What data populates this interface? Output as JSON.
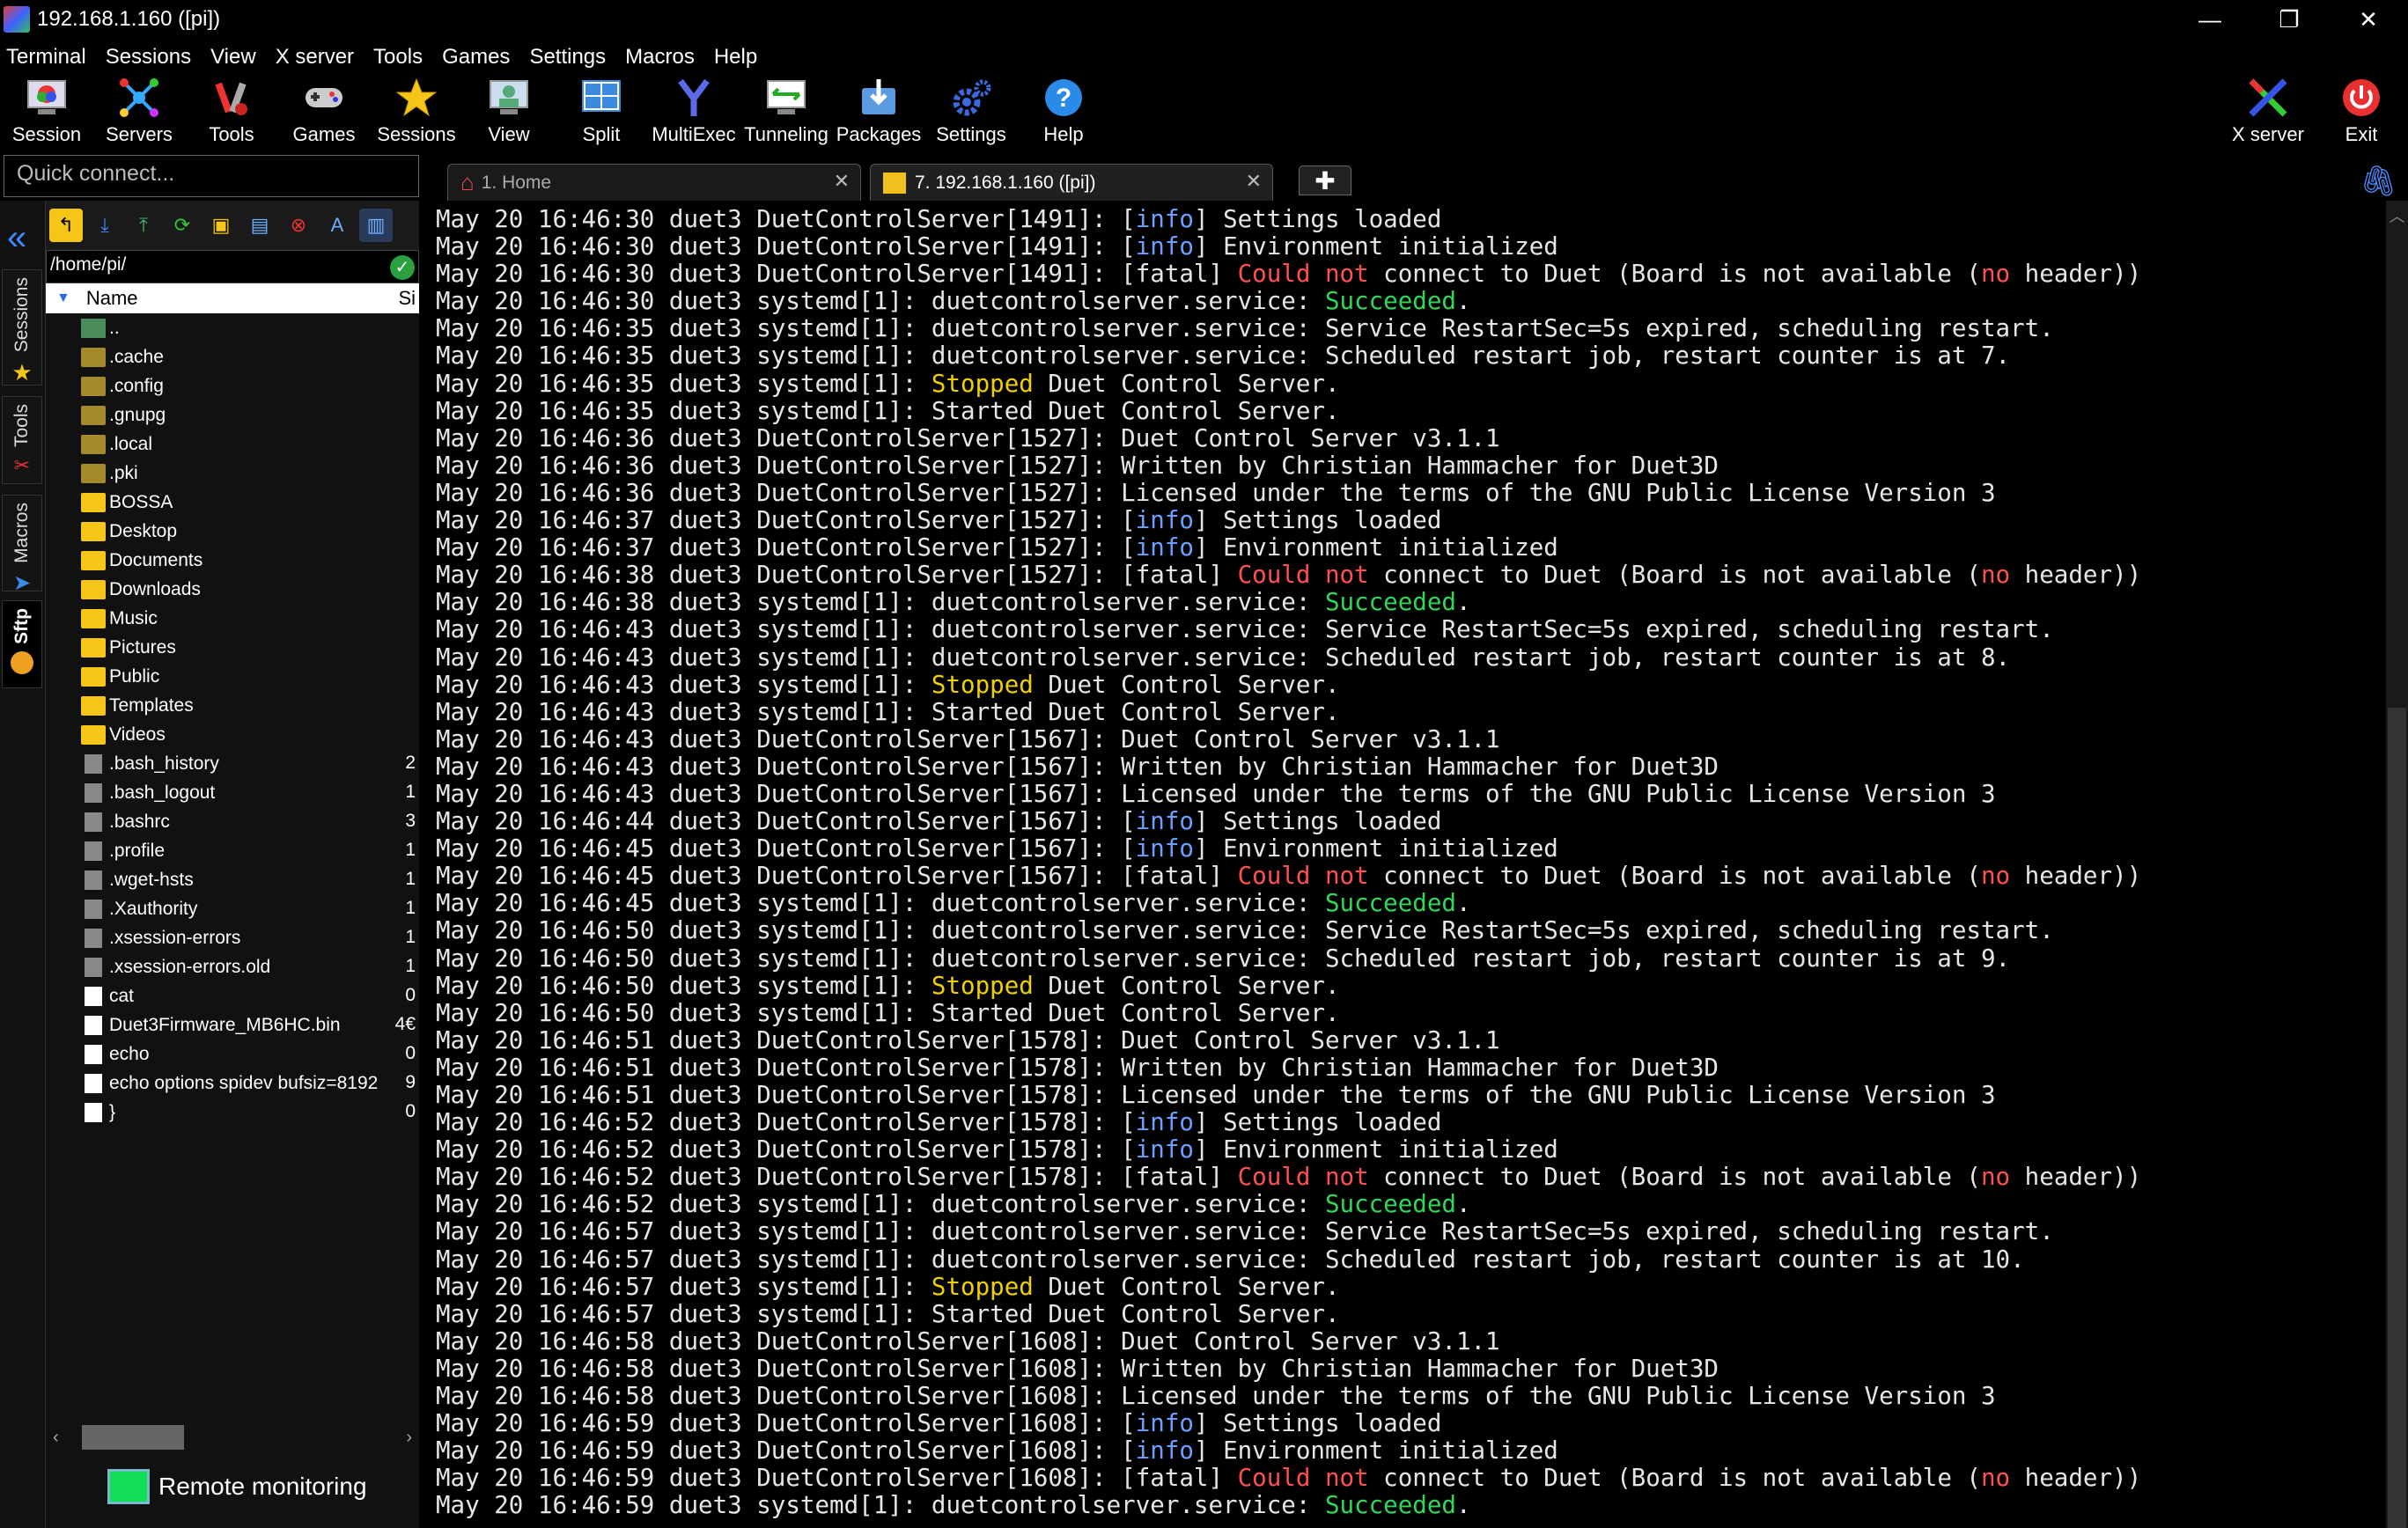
{
  "window": {
    "title": "192.168.1.160 ([pi])",
    "minimize": "—",
    "restore": "❐",
    "close": "✕"
  },
  "menu": [
    "Terminal",
    "Sessions",
    "View",
    "X server",
    "Tools",
    "Games",
    "Settings",
    "Macros",
    "Help"
  ],
  "toolbar": {
    "session": "Session",
    "servers": "Servers",
    "tools": "Tools",
    "games": "Games",
    "sessions": "Sessions",
    "view": "View",
    "split": "Split",
    "multiexec": "MultiExec",
    "tunneling": "Tunneling",
    "packages": "Packages",
    "settings": "Settings",
    "help": "Help",
    "xserver": "X server",
    "exit": "Exit"
  },
  "quick_connect": {
    "placeholder": "Quick connect..."
  },
  "tabs": [
    {
      "label": "1. Home"
    },
    {
      "label": "7. 192.168.1.160 ([pi])"
    }
  ],
  "side_tabs": {
    "sessions": "Sessions",
    "tools": "Tools",
    "macros": "Macros",
    "sftp": "Sftp"
  },
  "sftp": {
    "path": "/home/pi/",
    "col_name": "Name",
    "col_size": "Si",
    "files": [
      {
        "name": "..",
        "size": "",
        "kind": "up"
      },
      {
        "name": ".cache",
        "size": "",
        "kind": "hfolder"
      },
      {
        "name": ".config",
        "size": "",
        "kind": "hfolder"
      },
      {
        "name": ".gnupg",
        "size": "",
        "kind": "hfolder"
      },
      {
        "name": ".local",
        "size": "",
        "kind": "hfolder"
      },
      {
        "name": ".pki",
        "size": "",
        "kind": "hfolder"
      },
      {
        "name": "BOSSA",
        "size": "",
        "kind": "folder"
      },
      {
        "name": "Desktop",
        "size": "",
        "kind": "folder"
      },
      {
        "name": "Documents",
        "size": "",
        "kind": "folder"
      },
      {
        "name": "Downloads",
        "size": "",
        "kind": "folder"
      },
      {
        "name": "Music",
        "size": "",
        "kind": "folder"
      },
      {
        "name": "Pictures",
        "size": "",
        "kind": "folder"
      },
      {
        "name": "Public",
        "size": "",
        "kind": "folder"
      },
      {
        "name": "Templates",
        "size": "",
        "kind": "folder"
      },
      {
        "name": "Videos",
        "size": "",
        "kind": "folder"
      },
      {
        "name": ".bash_history",
        "size": "2",
        "kind": "hfile"
      },
      {
        "name": ".bash_logout",
        "size": "1",
        "kind": "hfile"
      },
      {
        "name": ".bashrc",
        "size": "3",
        "kind": "hfile"
      },
      {
        "name": ".profile",
        "size": "1",
        "kind": "hfile"
      },
      {
        "name": ".wget-hsts",
        "size": "1",
        "kind": "hfile"
      },
      {
        "name": ".Xauthority",
        "size": "1",
        "kind": "hfile"
      },
      {
        "name": ".xsession-errors",
        "size": "1",
        "kind": "hfile"
      },
      {
        "name": ".xsession-errors.old",
        "size": "1",
        "kind": "hfile"
      },
      {
        "name": "cat",
        "size": "0",
        "kind": "file"
      },
      {
        "name": "Duet3Firmware_MB6HC.bin",
        "size": "4€",
        "kind": "file"
      },
      {
        "name": "echo",
        "size": "0",
        "kind": "file"
      },
      {
        "name": "echo options spidev bufsiz=8192",
        "size": "9",
        "kind": "file"
      },
      {
        "name": "}",
        "size": "0",
        "kind": "file"
      }
    ],
    "monitor": "Remote monitoring"
  },
  "terminal": {
    "lines": [
      [
        [
          "May 20 16:46:30 duet3 DuetControlServer[1491]: [",
          ""
        ],
        [
          "info",
          "info"
        ],
        [
          "] Settings loaded",
          ""
        ]
      ],
      [
        [
          "May 20 16:46:30 duet3 DuetControlServer[1491]: [",
          ""
        ],
        [
          "info",
          "info"
        ],
        [
          "] Environment initialized",
          ""
        ]
      ],
      [
        [
          "May 20 16:46:30 duet3 DuetControlServer[1491]: [fatal] ",
          ""
        ],
        [
          "Could not",
          "red"
        ],
        [
          " connect to Duet (Board is not available (",
          ""
        ],
        [
          "no",
          "red"
        ],
        [
          " header))",
          ""
        ]
      ],
      [
        [
          "May 20 16:46:30 duet3 systemd[1]: duetcontrolserver.service: ",
          ""
        ],
        [
          "Succeeded",
          "grn"
        ],
        [
          ".",
          ""
        ]
      ],
      [
        [
          "May 20 16:46:35 duet3 systemd[1]: duetcontrolserver.service: Service RestartSec=5s expired, scheduling restart.",
          ""
        ]
      ],
      [
        [
          "May 20 16:46:35 duet3 systemd[1]: duetcontrolserver.service: Scheduled restart job, restart counter is at 7.",
          ""
        ]
      ],
      [
        [
          "May 20 16:46:35 duet3 systemd[1]: ",
          ""
        ],
        [
          "Stopped",
          "yel"
        ],
        [
          " Duet Control Server.",
          ""
        ]
      ],
      [
        [
          "May 20 16:46:35 duet3 systemd[1]: Started Duet Control Server.",
          ""
        ]
      ],
      [
        [
          "May 20 16:46:36 duet3 DuetControlServer[1527]: Duet Control Server v3.1.1",
          ""
        ]
      ],
      [
        [
          "May 20 16:46:36 duet3 DuetControlServer[1527]: Written by Christian Hammacher for Duet3D",
          ""
        ]
      ],
      [
        [
          "May 20 16:46:36 duet3 DuetControlServer[1527]: Licensed under the terms of the GNU Public License Version 3",
          ""
        ]
      ],
      [
        [
          "May 20 16:46:37 duet3 DuetControlServer[1527]: [",
          ""
        ],
        [
          "info",
          "info"
        ],
        [
          "] Settings loaded",
          ""
        ]
      ],
      [
        [
          "May 20 16:46:37 duet3 DuetControlServer[1527]: [",
          ""
        ],
        [
          "info",
          "info"
        ],
        [
          "] Environment initialized",
          ""
        ]
      ],
      [
        [
          "May 20 16:46:38 duet3 DuetControlServer[1527]: [fatal] ",
          ""
        ],
        [
          "Could not",
          "red"
        ],
        [
          " connect to Duet (Board is not available (",
          ""
        ],
        [
          "no",
          "red"
        ],
        [
          " header))",
          ""
        ]
      ],
      [
        [
          "May 20 16:46:38 duet3 systemd[1]: duetcontrolserver.service: ",
          ""
        ],
        [
          "Succeeded",
          "grn"
        ],
        [
          ".",
          ""
        ]
      ],
      [
        [
          "May 20 16:46:43 duet3 systemd[1]: duetcontrolserver.service: Service RestartSec=5s expired, scheduling restart.",
          ""
        ]
      ],
      [
        [
          "May 20 16:46:43 duet3 systemd[1]: duetcontrolserver.service: Scheduled restart job, restart counter is at 8.",
          ""
        ]
      ],
      [
        [
          "May 20 16:46:43 duet3 systemd[1]: ",
          ""
        ],
        [
          "Stopped",
          "yel"
        ],
        [
          " Duet Control Server.",
          ""
        ]
      ],
      [
        [
          "May 20 16:46:43 duet3 systemd[1]: Started Duet Control Server.",
          ""
        ]
      ],
      [
        [
          "May 20 16:46:43 duet3 DuetControlServer[1567]: Duet Control Server v3.1.1",
          ""
        ]
      ],
      [
        [
          "May 20 16:46:43 duet3 DuetControlServer[1567]: Written by Christian Hammacher for Duet3D",
          ""
        ]
      ],
      [
        [
          "May 20 16:46:43 duet3 DuetControlServer[1567]: Licensed under the terms of the GNU Public License Version 3",
          ""
        ]
      ],
      [
        [
          "May 20 16:46:44 duet3 DuetControlServer[1567]: [",
          ""
        ],
        [
          "info",
          "info"
        ],
        [
          "] Settings loaded",
          ""
        ]
      ],
      [
        [
          "May 20 16:46:45 duet3 DuetControlServer[1567]: [",
          ""
        ],
        [
          "info",
          "info"
        ],
        [
          "] Environment initialized",
          ""
        ]
      ],
      [
        [
          "May 20 16:46:45 duet3 DuetControlServer[1567]: [fatal] ",
          ""
        ],
        [
          "Could not",
          "red"
        ],
        [
          " connect to Duet (Board is not available (",
          ""
        ],
        [
          "no",
          "red"
        ],
        [
          " header))",
          ""
        ]
      ],
      [
        [
          "May 20 16:46:45 duet3 systemd[1]: duetcontrolserver.service: ",
          ""
        ],
        [
          "Succeeded",
          "grn"
        ],
        [
          ".",
          ""
        ]
      ],
      [
        [
          "May 20 16:46:50 duet3 systemd[1]: duetcontrolserver.service: Service RestartSec=5s expired, scheduling restart.",
          ""
        ]
      ],
      [
        [
          "May 20 16:46:50 duet3 systemd[1]: duetcontrolserver.service: Scheduled restart job, restart counter is at 9.",
          ""
        ]
      ],
      [
        [
          "May 20 16:46:50 duet3 systemd[1]: ",
          ""
        ],
        [
          "Stopped",
          "yel"
        ],
        [
          " Duet Control Server.",
          ""
        ]
      ],
      [
        [
          "May 20 16:46:50 duet3 systemd[1]: Started Duet Control Server.",
          ""
        ]
      ],
      [
        [
          "May 20 16:46:51 duet3 DuetControlServer[1578]: Duet Control Server v3.1.1",
          ""
        ]
      ],
      [
        [
          "May 20 16:46:51 duet3 DuetControlServer[1578]: Written by Christian Hammacher for Duet3D",
          ""
        ]
      ],
      [
        [
          "May 20 16:46:51 duet3 DuetControlServer[1578]: Licensed under the terms of the GNU Public License Version 3",
          ""
        ]
      ],
      [
        [
          "May 20 16:46:52 duet3 DuetControlServer[1578]: [",
          ""
        ],
        [
          "info",
          "info"
        ],
        [
          "] Settings loaded",
          ""
        ]
      ],
      [
        [
          "May 20 16:46:52 duet3 DuetControlServer[1578]: [",
          ""
        ],
        [
          "info",
          "info"
        ],
        [
          "] Environment initialized",
          ""
        ]
      ],
      [
        [
          "May 20 16:46:52 duet3 DuetControlServer[1578]: [fatal] ",
          ""
        ],
        [
          "Could not",
          "red"
        ],
        [
          " connect to Duet (Board is not available (",
          ""
        ],
        [
          "no",
          "red"
        ],
        [
          " header))",
          ""
        ]
      ],
      [
        [
          "May 20 16:46:52 duet3 systemd[1]: duetcontrolserver.service: ",
          ""
        ],
        [
          "Succeeded",
          "grn"
        ],
        [
          ".",
          ""
        ]
      ],
      [
        [
          "May 20 16:46:57 duet3 systemd[1]: duetcontrolserver.service: Service RestartSec=5s expired, scheduling restart.",
          ""
        ]
      ],
      [
        [
          "May 20 16:46:57 duet3 systemd[1]: duetcontrolserver.service: Scheduled restart job, restart counter is at 10.",
          ""
        ]
      ],
      [
        [
          "May 20 16:46:57 duet3 systemd[1]: ",
          ""
        ],
        [
          "Stopped",
          "yel"
        ],
        [
          " Duet Control Server.",
          ""
        ]
      ],
      [
        [
          "May 20 16:46:57 duet3 systemd[1]: Started Duet Control Server.",
          ""
        ]
      ],
      [
        [
          "May 20 16:46:58 duet3 DuetControlServer[1608]: Duet Control Server v3.1.1",
          ""
        ]
      ],
      [
        [
          "May 20 16:46:58 duet3 DuetControlServer[1608]: Written by Christian Hammacher for Duet3D",
          ""
        ]
      ],
      [
        [
          "May 20 16:46:58 duet3 DuetControlServer[1608]: Licensed under the terms of the GNU Public License Version 3",
          ""
        ]
      ],
      [
        [
          "May 20 16:46:59 duet3 DuetControlServer[1608]: [",
          ""
        ],
        [
          "info",
          "info"
        ],
        [
          "] Settings loaded",
          ""
        ]
      ],
      [
        [
          "May 20 16:46:59 duet3 DuetControlServer[1608]: [",
          ""
        ],
        [
          "info",
          "info"
        ],
        [
          "] Environment initialized",
          ""
        ]
      ],
      [
        [
          "May 20 16:46:59 duet3 DuetControlServer[1608]: [fatal] ",
          ""
        ],
        [
          "Could not",
          "red"
        ],
        [
          " connect to Duet (Board is not available (",
          ""
        ],
        [
          "no",
          "red"
        ],
        [
          " header))",
          ""
        ]
      ],
      [
        [
          "May 20 16:46:59 duet3 systemd[1]: duetcontrolserver.service: ",
          ""
        ],
        [
          "Succeeded",
          "grn"
        ],
        [
          ".",
          ""
        ]
      ]
    ]
  },
  "colors": {
    "info": "#6aa0ff",
    "error": "#ff5050",
    "warn": "#f0d000",
    "ok": "#30d858"
  }
}
